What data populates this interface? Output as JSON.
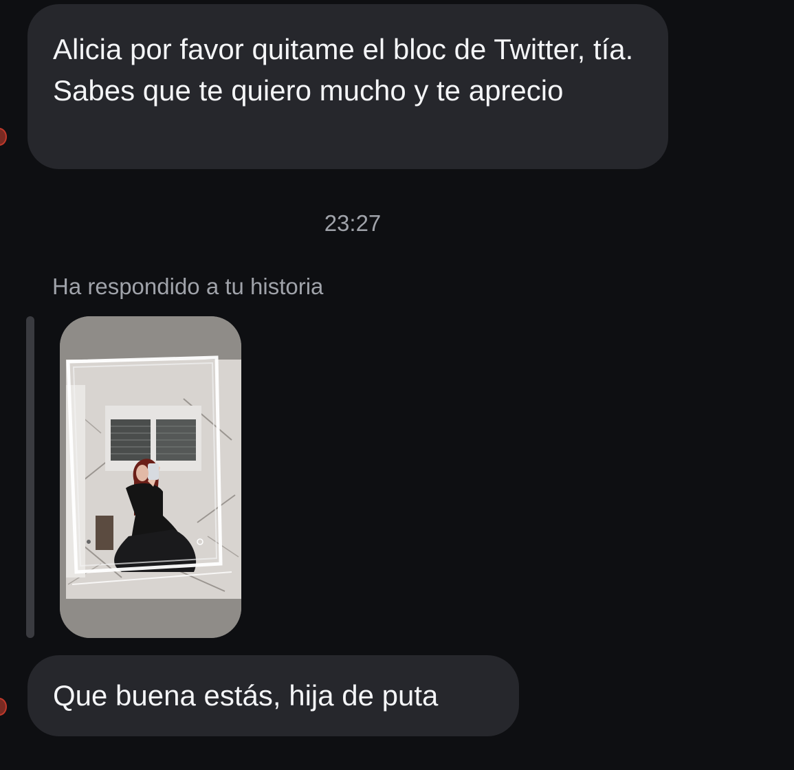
{
  "conversation": {
    "message_1": "Alicia por favor quitame el bloc de Twitter, tía. Sabes que te quiero mucho y te aprecio",
    "timestamp": "23:27",
    "reply_note": "Ha respondido a tu historia",
    "message_2": "Que buena estás, hija de puta"
  },
  "colors": {
    "background": "#0e0f12",
    "bubble": "#26272c",
    "secondary_text": "#a0a3aa",
    "story_card": "#8f8c88"
  },
  "icons": {
    "sender_avatar": "avatar-icon"
  }
}
